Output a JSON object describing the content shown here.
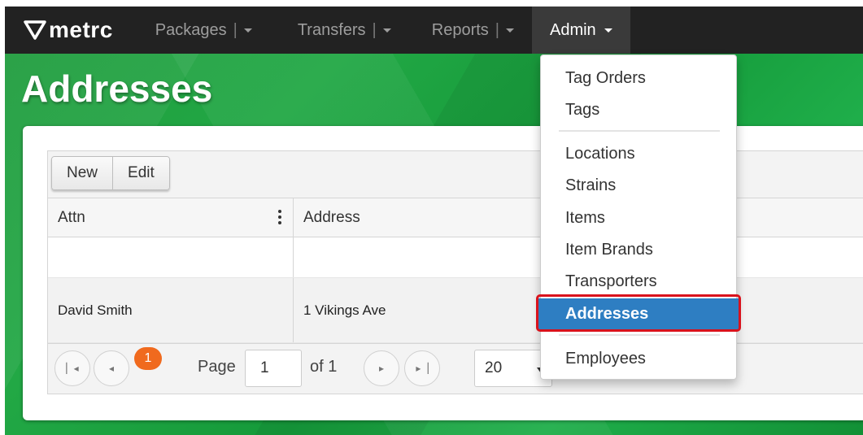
{
  "brand": {
    "name": "metrc"
  },
  "nav": {
    "items": [
      {
        "label": "Packages"
      },
      {
        "label": "Transfers"
      },
      {
        "label": "Reports"
      }
    ],
    "active": {
      "label": "Admin"
    }
  },
  "page": {
    "title": "Addresses"
  },
  "toolbar": {
    "new_label": "New",
    "edit_label": "Edit"
  },
  "table": {
    "columns": [
      "Attn",
      "Address"
    ],
    "rows": [
      {
        "attn": "",
        "address": ""
      },
      {
        "attn": "David Smith",
        "address": "1 Vikings Ave"
      }
    ]
  },
  "pager": {
    "current_page": "1",
    "page_label": "Page",
    "page_input": "1",
    "of_label": "of 1",
    "page_size": "20"
  },
  "admin_menu": {
    "items": [
      "Tag Orders",
      "Tags",
      "Locations",
      "Strains",
      "Items",
      "Item Brands",
      "Transporters",
      "Addresses",
      "Employees"
    ],
    "selected": "Addresses"
  },
  "colors": {
    "navbar": "#222222",
    "accent_green": "#1fa244",
    "menu_active": "#2e7ec2",
    "page_badge": "#f06a1e",
    "highlight_border": "#d9121c"
  }
}
